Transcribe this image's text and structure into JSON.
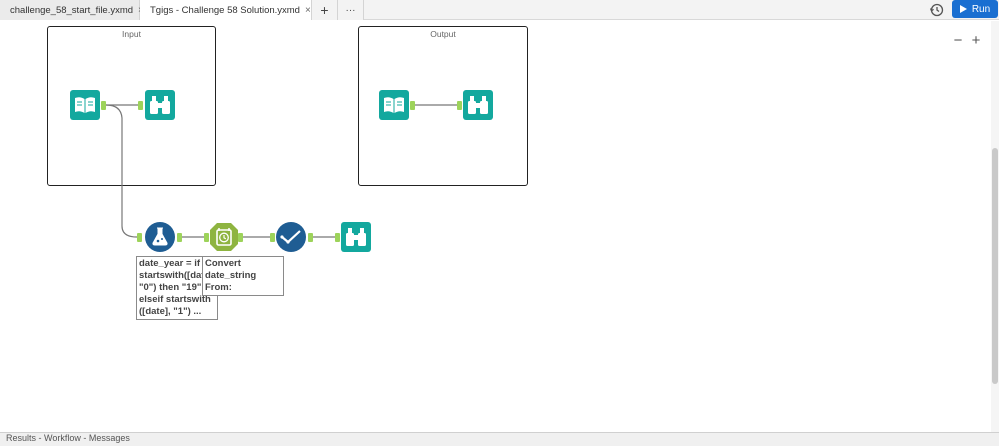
{
  "tabs": [
    {
      "label": "challenge_58_start_file.yxmd",
      "close": "×"
    },
    {
      "label": "Tgigs - Challenge 58 Solution.yxmd",
      "close": "×"
    }
  ],
  "tab_actions": {
    "add": "+",
    "more": "···"
  },
  "toolbar": {
    "run_label": "Run",
    "run_color": "#1a6fd1"
  },
  "zoom": {
    "out": "−",
    "in": "+"
  },
  "containers": [
    {
      "title": "Input"
    },
    {
      "title": "Output"
    }
  ],
  "tools": [
    {
      "name": "input-data-tool",
      "icon": "open-book-icon",
      "color": "#13a89e"
    },
    {
      "name": "browse-tool",
      "icon": "binoculars-icon",
      "color": "#13a89e"
    },
    {
      "name": "input-data-tool-output",
      "icon": "open-book-icon",
      "color": "#13a89e"
    },
    {
      "name": "browse-tool-output",
      "icon": "binoculars-icon",
      "color": "#13a89e"
    },
    {
      "name": "formula-tool",
      "icon": "flask-icon",
      "color": "#1f5d93"
    },
    {
      "name": "datetime-tool",
      "icon": "clock-icon",
      "color": "#8eb440"
    },
    {
      "name": "select-tool",
      "icon": "checkmark-icon",
      "color": "#1f5d93"
    },
    {
      "name": "browse-tool-final",
      "icon": "binoculars-icon",
      "color": "#13a89e"
    }
  ],
  "annotations": {
    "formula": "date_year = if\nstartswith([date\n\"0\") then \"19\"\nelseif startswith\n([date], \"1\") ...",
    "datetime": "Convert\ndate_string From:\nyyyyMMdd"
  },
  "bottom_bar": {
    "text": "Results - Workflow - Messages"
  }
}
